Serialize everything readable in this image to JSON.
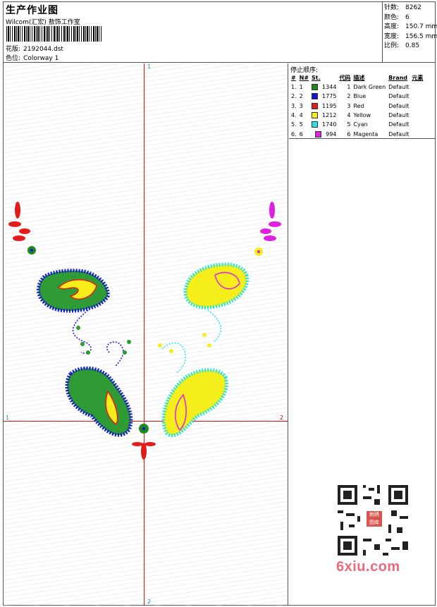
{
  "header": {
    "title": "生产作业图",
    "software": "Wilcom(汇宏) 敖饰工作室",
    "design_label": "花版:",
    "design_file": "2192044.dst",
    "colorway_label": "色位:",
    "colorway": "Colorway 1"
  },
  "stats": {
    "stitches_label": "针数:",
    "stitches": "8262",
    "colors_label": "颜色:",
    "colors": "6",
    "height_label": "高度:",
    "height": "150.7 mm",
    "width_label": "宽度:",
    "width": "156.5 mm",
    "scale_label": "比例:",
    "scale": "0.85"
  },
  "stop_sequence_label": "停止顺序:",
  "table": {
    "columns": [
      "#",
      "N#",
      "St.",
      "代码",
      "描述",
      "Brand",
      "元素"
    ],
    "rows": [
      {
        "idx": "1.",
        "n": "1",
        "color": "#1e8a1e",
        "st": "1344",
        "code": "1",
        "desc": "Dark Green",
        "brand": "Default"
      },
      {
        "idx": "2.",
        "n": "2",
        "color": "#1414d8",
        "st": "1775",
        "code": "2",
        "desc": "Blue",
        "brand": "Default"
      },
      {
        "idx": "3.",
        "n": "3",
        "color": "#e31b1b",
        "st": "1195",
        "code": "3",
        "desc": "Red",
        "brand": "Default"
      },
      {
        "idx": "4.",
        "n": "4",
        "color": "#f5ee1a",
        "st": "1212",
        "code": "4",
        "desc": "Yellow",
        "brand": "Default"
      },
      {
        "idx": "5.",
        "n": "5",
        "color": "#22e3e8",
        "st": "1740",
        "code": "5",
        "desc": "Cyan",
        "brand": "Default"
      },
      {
        "idx": "6.",
        "n": "6",
        "color": "#e020e0",
        "st": "994",
        "code": "6",
        "desc": "Magenta",
        "brand": "Default"
      }
    ]
  },
  "axis": {
    "top": "1",
    "bottom": "2",
    "left": "1",
    "right": "2"
  },
  "watermark": {
    "text": "6xiu.com",
    "qr_center": "刺绣 图库"
  }
}
